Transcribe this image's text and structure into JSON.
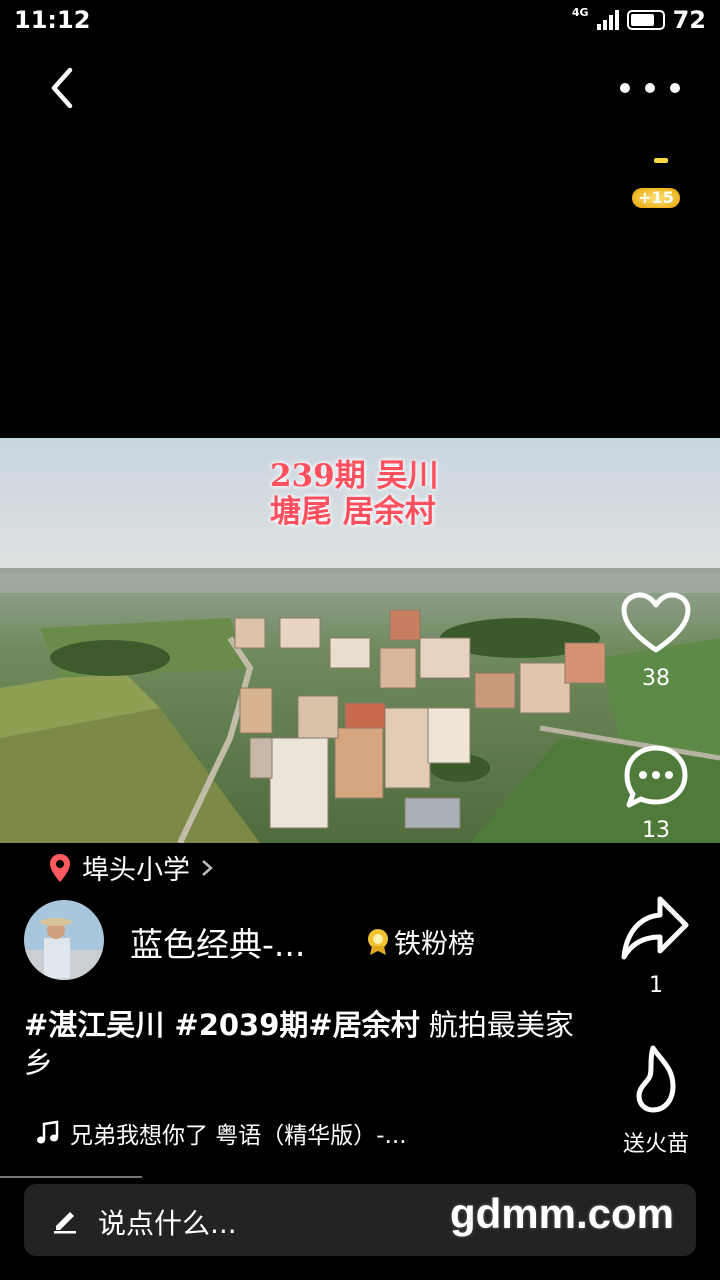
{
  "status": {
    "time": "11:12",
    "network": "4G",
    "battery": "72"
  },
  "badge": {
    "count": "+15"
  },
  "video": {
    "caption_line1": "239期 吴川",
    "caption_line2": "塘尾 居余村"
  },
  "actions": {
    "likes": "38",
    "comments": "13",
    "shares": "1",
    "gift_label": "送火苗"
  },
  "location": {
    "label": "埠头小学"
  },
  "author": {
    "name": "蓝色经典-...",
    "fans_label": "铁粉榜"
  },
  "description": {
    "hashtags": "#湛江吴川 #2039期#居余村",
    "text": " 航拍最美家乡"
  },
  "music": {
    "title": "兄弟我想你了 粤语（精华版）-..."
  },
  "comment": {
    "placeholder": "说点什么...",
    "watermark": "gdmm.com"
  },
  "colors": {
    "accent_red": "#ff5060",
    "location_pin": "#ff5a5f",
    "fans_gold": "#f2c230"
  }
}
